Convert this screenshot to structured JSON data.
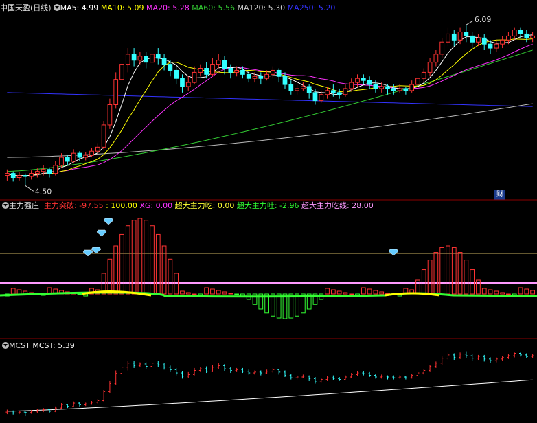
{
  "panel1": {
    "title": "中国天盈(日线)",
    "ma": [
      {
        "label": "MA5: 4.99",
        "color": "#ffffff"
      },
      {
        "label": "MA10: 5.09",
        "color": "#ffff00"
      },
      {
        "label": "MA20: 5.28",
        "color": "#ff33ff"
      },
      {
        "label": "MA60: 5.56",
        "color": "#33cc33"
      },
      {
        "label": "MA120: 5.30",
        "color": "#cccccc"
      },
      {
        "label": "MA250: 5.20",
        "color": "#3333ff"
      }
    ],
    "high_label": "6.09",
    "low_label": "4.50",
    "badge": "财"
  },
  "panel2": {
    "title": "主力强庄",
    "items": [
      {
        "label": "主力突破: -97.55",
        "color": "#ff3333"
      },
      {
        "label": ": 100.00",
        "color": "#ffff00"
      },
      {
        "label": "XG: 0.00",
        "color": "#ff33ff"
      },
      {
        "label": "超大主力吃: 0.00",
        "color": "#ffff33"
      },
      {
        "label": "超大主力吐: -2.96",
        "color": "#33ff33"
      },
      {
        "label": "超大主力吃线: 28.00",
        "color": "#ff99ff"
      }
    ]
  },
  "panel3": {
    "title": "MCST",
    "items": [
      {
        "label": "MCST: 5.39",
        "color": "#ffffff"
      }
    ]
  },
  "chart_data": {
    "type": "candlestick",
    "price_range": [
      4.4,
      6.2
    ],
    "candles": [
      [
        4.6,
        4.62,
        4.55,
        4.66
      ],
      [
        4.62,
        4.58,
        4.54,
        4.64
      ],
      [
        4.58,
        4.6,
        4.55,
        4.63
      ],
      [
        4.6,
        4.59,
        4.5,
        4.62
      ],
      [
        4.59,
        4.62,
        4.56,
        4.65
      ],
      [
        4.62,
        4.64,
        4.58,
        4.67
      ],
      [
        4.64,
        4.66,
        4.6,
        4.7
      ],
      [
        4.66,
        4.62,
        4.58,
        4.68
      ],
      [
        4.62,
        4.7,
        4.6,
        4.74
      ],
      [
        4.7,
        4.78,
        4.68,
        4.82
      ],
      [
        4.78,
        4.74,
        4.7,
        4.8
      ],
      [
        4.74,
        4.82,
        4.72,
        4.86
      ],
      [
        4.82,
        4.78,
        4.74,
        4.84
      ],
      [
        4.78,
        4.8,
        4.75,
        4.83
      ],
      [
        4.8,
        4.84,
        4.78,
        4.87
      ],
      [
        4.84,
        4.88,
        4.8,
        4.92
      ],
      [
        4.88,
        5.1,
        4.86,
        5.14
      ],
      [
        5.1,
        5.3,
        5.06,
        5.36
      ],
      [
        5.3,
        5.55,
        5.26,
        5.62
      ],
      [
        5.55,
        5.7,
        5.5,
        5.78
      ],
      [
        5.7,
        5.8,
        5.62,
        5.86
      ],
      [
        5.8,
        5.74,
        5.68,
        5.86
      ],
      [
        5.74,
        5.78,
        5.7,
        5.82
      ],
      [
        5.78,
        5.72,
        5.66,
        5.82
      ],
      [
        5.72,
        5.8,
        5.7,
        5.92
      ],
      [
        5.8,
        5.76,
        5.7,
        5.86
      ],
      [
        5.76,
        5.7,
        5.64,
        5.8
      ],
      [
        5.7,
        5.64,
        5.58,
        5.74
      ],
      [
        5.64,
        5.56,
        5.5,
        5.68
      ],
      [
        5.56,
        5.48,
        5.42,
        5.6
      ],
      [
        5.48,
        5.52,
        5.44,
        5.58
      ],
      [
        5.52,
        5.62,
        5.5,
        5.68
      ],
      [
        5.62,
        5.66,
        5.58,
        5.7
      ],
      [
        5.66,
        5.6,
        5.56,
        5.72
      ],
      [
        5.6,
        5.7,
        5.58,
        5.76
      ],
      [
        5.7,
        5.74,
        5.66,
        5.8
      ],
      [
        5.74,
        5.66,
        5.6,
        5.78
      ],
      [
        5.66,
        5.62,
        5.56,
        5.7
      ],
      [
        5.62,
        5.64,
        5.58,
        5.68
      ],
      [
        5.64,
        5.6,
        5.56,
        5.68
      ],
      [
        5.6,
        5.56,
        5.52,
        5.64
      ],
      [
        5.56,
        5.58,
        5.52,
        5.62
      ],
      [
        5.58,
        5.56,
        5.5,
        5.62
      ],
      [
        5.56,
        5.6,
        5.54,
        5.64
      ],
      [
        5.6,
        5.64,
        5.56,
        5.68
      ],
      [
        5.64,
        5.58,
        5.52,
        5.66
      ],
      [
        5.58,
        5.5,
        5.46,
        5.62
      ],
      [
        5.5,
        5.44,
        5.4,
        5.54
      ],
      [
        5.44,
        5.46,
        5.4,
        5.5
      ],
      [
        5.46,
        5.48,
        5.44,
        5.52
      ],
      [
        5.48,
        5.42,
        5.36,
        5.5
      ],
      [
        5.42,
        5.34,
        5.3,
        5.46
      ],
      [
        5.34,
        5.4,
        5.32,
        5.44
      ],
      [
        5.4,
        5.44,
        5.36,
        5.48
      ],
      [
        5.44,
        5.42,
        5.38,
        5.5
      ],
      [
        5.42,
        5.4,
        5.36,
        5.46
      ],
      [
        5.4,
        5.46,
        5.38,
        5.5
      ],
      [
        5.46,
        5.52,
        5.44,
        5.56
      ],
      [
        5.52,
        5.56,
        5.48,
        5.6
      ],
      [
        5.56,
        5.54,
        5.5,
        5.6
      ],
      [
        5.54,
        5.5,
        5.46,
        5.58
      ],
      [
        5.5,
        5.46,
        5.42,
        5.54
      ],
      [
        5.46,
        5.48,
        5.42,
        5.52
      ],
      [
        5.48,
        5.46,
        5.4,
        5.5
      ],
      [
        5.46,
        5.44,
        5.4,
        5.5
      ],
      [
        5.44,
        5.46,
        5.42,
        5.5
      ],
      [
        5.46,
        5.44,
        5.4,
        5.48
      ],
      [
        5.44,
        5.5,
        5.42,
        5.54
      ],
      [
        5.5,
        5.56,
        5.46,
        5.6
      ],
      [
        5.56,
        5.62,
        5.52,
        5.66
      ],
      [
        5.62,
        5.72,
        5.58,
        5.76
      ],
      [
        5.72,
        5.8,
        5.68,
        5.84
      ],
      [
        5.8,
        5.92,
        5.76,
        5.96
      ],
      [
        5.92,
        6.0,
        5.88,
        6.06
      ],
      [
        6.0,
        5.94,
        5.88,
        6.04
      ],
      [
        5.94,
        6.02,
        5.9,
        6.06
      ],
      [
        6.02,
        5.98,
        5.92,
        6.09
      ],
      [
        5.98,
        5.92,
        5.86,
        6.02
      ],
      [
        5.92,
        5.96,
        5.88,
        6.0
      ],
      [
        5.96,
        5.9,
        5.84,
        6.0
      ],
      [
        5.9,
        5.86,
        5.8,
        5.94
      ],
      [
        5.86,
        5.9,
        5.82,
        5.94
      ],
      [
        5.9,
        5.94,
        5.86,
        5.98
      ],
      [
        5.94,
        5.98,
        5.9,
        6.02
      ],
      [
        5.98,
        6.04,
        5.94,
        6.06
      ],
      [
        6.04,
        6.0,
        5.96,
        6.06
      ],
      [
        6.0,
        5.96,
        5.92,
        6.04
      ],
      [
        5.96,
        5.98,
        5.92,
        6.02
      ]
    ],
    "mcst": 5.39
  }
}
